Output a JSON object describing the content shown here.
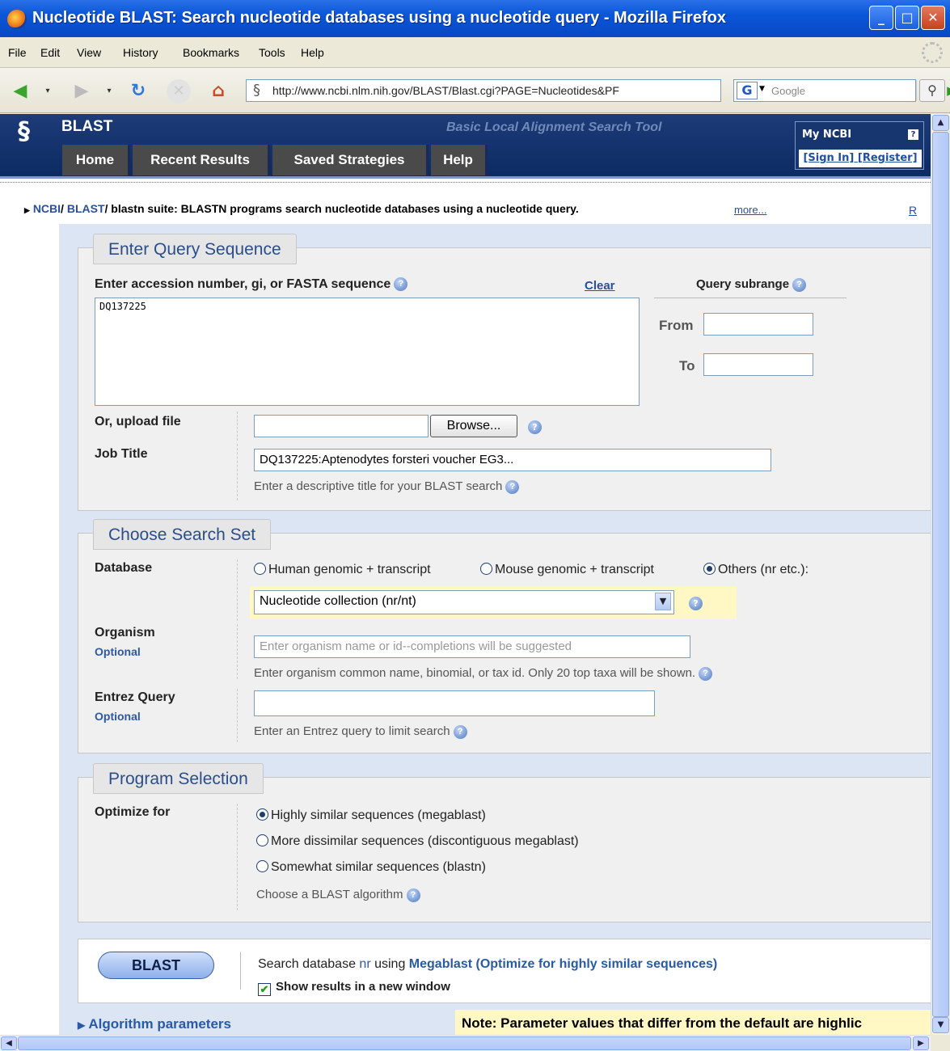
{
  "window": {
    "title": "Nucleotide BLAST: Search nucleotide databases using a nucleotide query - Mozilla Firefox"
  },
  "menu": [
    "File",
    "Edit",
    "View",
    "History",
    "Bookmarks",
    "Tools",
    "Help"
  ],
  "nav": {
    "url": "http://www.ncbi.nlm.nih.gov/BLAST/Blast.cgi?PAGE=Nucleotides&PF",
    "search_placeholder": "Google",
    "search_engine_letter": "G"
  },
  "header": {
    "app_name": "BLAST",
    "tagline": "Basic Local Alignment Search Tool",
    "tabs": [
      "Home",
      "Recent Results",
      "Saved Strategies",
      "Help"
    ],
    "myncbi": {
      "title": "My NCBI",
      "help_glyph": "?",
      "sign_in": "[Sign In]",
      "register": "[Register]"
    }
  },
  "breadcrumb": {
    "ncbi": "NCBI",
    "sep1": "/",
    "blast": "BLAST",
    "sep2": "/",
    "text": " blastn suite: BLASTN programs search nucleotide databases using a nucleotide query.",
    "more": "more...",
    "right": "R"
  },
  "query": {
    "legend": "Enter Query Sequence",
    "seq_label": "Enter accession number, gi, or FASTA sequence",
    "clear": "Clear",
    "sequence": "DQ137225",
    "subrange_label": "Query subrange",
    "from_label": "From",
    "to_label": "To",
    "upload_label": "Or, upload file",
    "browse": "Browse...",
    "job_title_label": "Job Title",
    "job_title_value": "DQ137225:Aptenodytes forsteri voucher EG3...",
    "job_title_hint": "Enter a descriptive title for your BLAST search"
  },
  "search_set": {
    "legend": "Choose Search Set",
    "db_label": "Database",
    "db_options": [
      {
        "label": "Human genomic + transcript",
        "checked": false
      },
      {
        "label": "Mouse genomic + transcript",
        "checked": false
      },
      {
        "label": "Others (nr etc.):",
        "checked": true
      }
    ],
    "db_selected": "Nucleotide collection (nr/nt)",
    "organism_label": "Organism",
    "optional": "Optional",
    "organism_placeholder": "Enter organism name or id--completions will be suggested",
    "organism_hint": "Enter organism common name, binomial, or tax id. Only 20 top taxa will be shown.",
    "entrez_label": "Entrez Query",
    "entrez_hint": "Enter an Entrez query to limit search"
  },
  "program": {
    "legend": "Program Selection",
    "optimize_label": "Optimize for",
    "options": [
      {
        "label": "Highly similar sequences (megablast)",
        "checked": true
      },
      {
        "label": "More dissimilar sequences (discontiguous megablast)",
        "checked": false
      },
      {
        "label": "Somewhat similar sequences (blastn)",
        "checked": false
      }
    ],
    "hint": "Choose a BLAST algorithm"
  },
  "submit": {
    "button": "BLAST",
    "summary_prefix": "Search database ",
    "summary_db": "nr",
    "summary_mid": " using ",
    "summary_algo": "Megablast (Optimize for highly similar sequences)",
    "new_window_label": "Show results in a new window",
    "new_window_checked": true
  },
  "algorithm": {
    "label": "Algorithm parameters",
    "note": "Note: Parameter values that differ from the default are highlic"
  },
  "colors": {
    "title_bar": "#0a56d8",
    "header_bg": "#0c2a63",
    "legend_text": "#2b4e8a",
    "link": "#2a5aa6",
    "form_bg": "#f0f0f0",
    "note_bg": "#fff7c4"
  }
}
